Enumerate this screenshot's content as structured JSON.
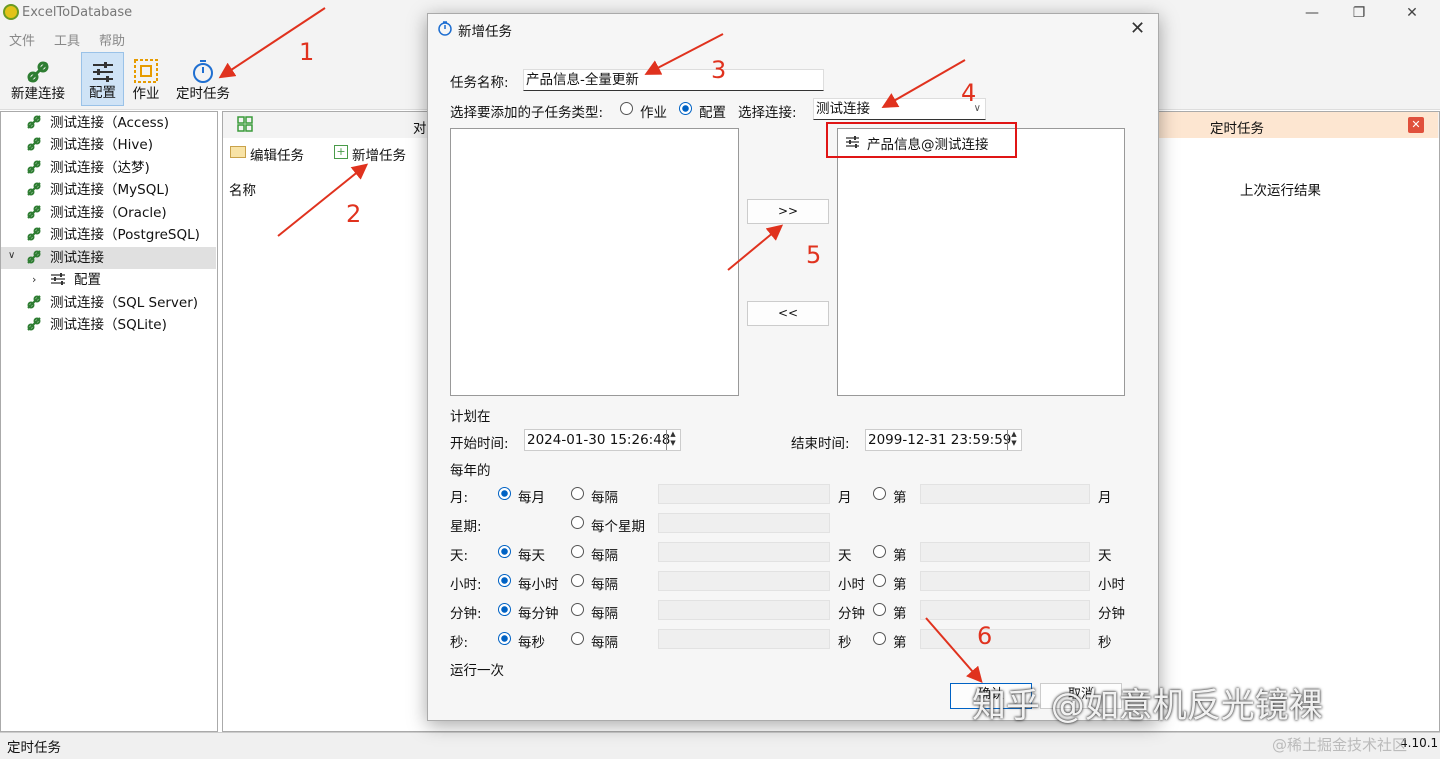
{
  "app": {
    "title": "ExcelToDatabase",
    "version": "4.10.1"
  },
  "menu": [
    "文件",
    "工具",
    "帮助"
  ],
  "toolbar": {
    "new_connection": "新建连接",
    "config": "配置",
    "job": "作业",
    "scheduled": "定时任务"
  },
  "tree": {
    "items": [
      "测试连接（Access)",
      "测试连接（Hive)",
      "测试连接（达梦)",
      "测试连接（MySQL)",
      "测试连接（Oracle)",
      "测试连接（PostgreSQL)",
      "测试连接",
      "配置",
      "测试连接（SQL Server)",
      "测试连接（SQLite)"
    ]
  },
  "main": {
    "tab_partial": "对",
    "edit_task": "编辑任务",
    "add_task": "新增任务",
    "col_name": "名称",
    "col_last_result": "上次运行结果",
    "sched_tab": "定时任务"
  },
  "status": {
    "left": "定时任务"
  },
  "dialog": {
    "title": "新增任务",
    "task_name_label": "任务名称:",
    "task_name_value": "产品信息-全量更新",
    "subtype_label": "选择要添加的子任务类型:",
    "opt_job": "作业",
    "opt_config": "配置",
    "select_conn_label": "选择连接:",
    "select_conn_value": "测试连接",
    "selected_item": "产品信息@测试连接",
    "add_btn": ">>",
    "remove_btn": "<<",
    "plan_label": "计划在",
    "start_label": "开始时间:",
    "start_value": "2024-01-30 15:26:48",
    "end_label": "结束时间:",
    "end_value": "2099-12-31 23:59:59",
    "yearly_label": "每年的",
    "rows": [
      {
        "label": "月:",
        "every": "每月",
        "interval": "每隔",
        "unit": "月",
        "nth": "第",
        "unit2": "月"
      },
      {
        "label": "星期:",
        "every": "",
        "interval": "每个星期",
        "unit": "",
        "nth": "",
        "unit2": ""
      },
      {
        "label": "天:",
        "every": "每天",
        "interval": "每隔",
        "unit": "天",
        "nth": "第",
        "unit2": "天"
      },
      {
        "label": "小时:",
        "every": "每小时",
        "interval": "每隔",
        "unit": "小时",
        "nth": "第",
        "unit2": "小时"
      },
      {
        "label": "分钟:",
        "every": "每分钟",
        "interval": "每隔",
        "unit": "分钟",
        "nth": "第",
        "unit2": "分钟"
      },
      {
        "label": "秒:",
        "every": "每秒",
        "interval": "每隔",
        "unit": "秒",
        "nth": "第",
        "unit2": "秒"
      }
    ],
    "run_once": "运行一次",
    "ok_btn": "确认",
    "cancel_btn": "取消"
  },
  "annotations": [
    "1",
    "2",
    "3",
    "4",
    "5",
    "6"
  ],
  "watermark": {
    "main": "知乎 @如意机反光镜裸",
    "sub": "@稀土掘金技术社区"
  },
  "colors": {
    "accent": "#0062c4",
    "arrow": "#e0321e"
  }
}
